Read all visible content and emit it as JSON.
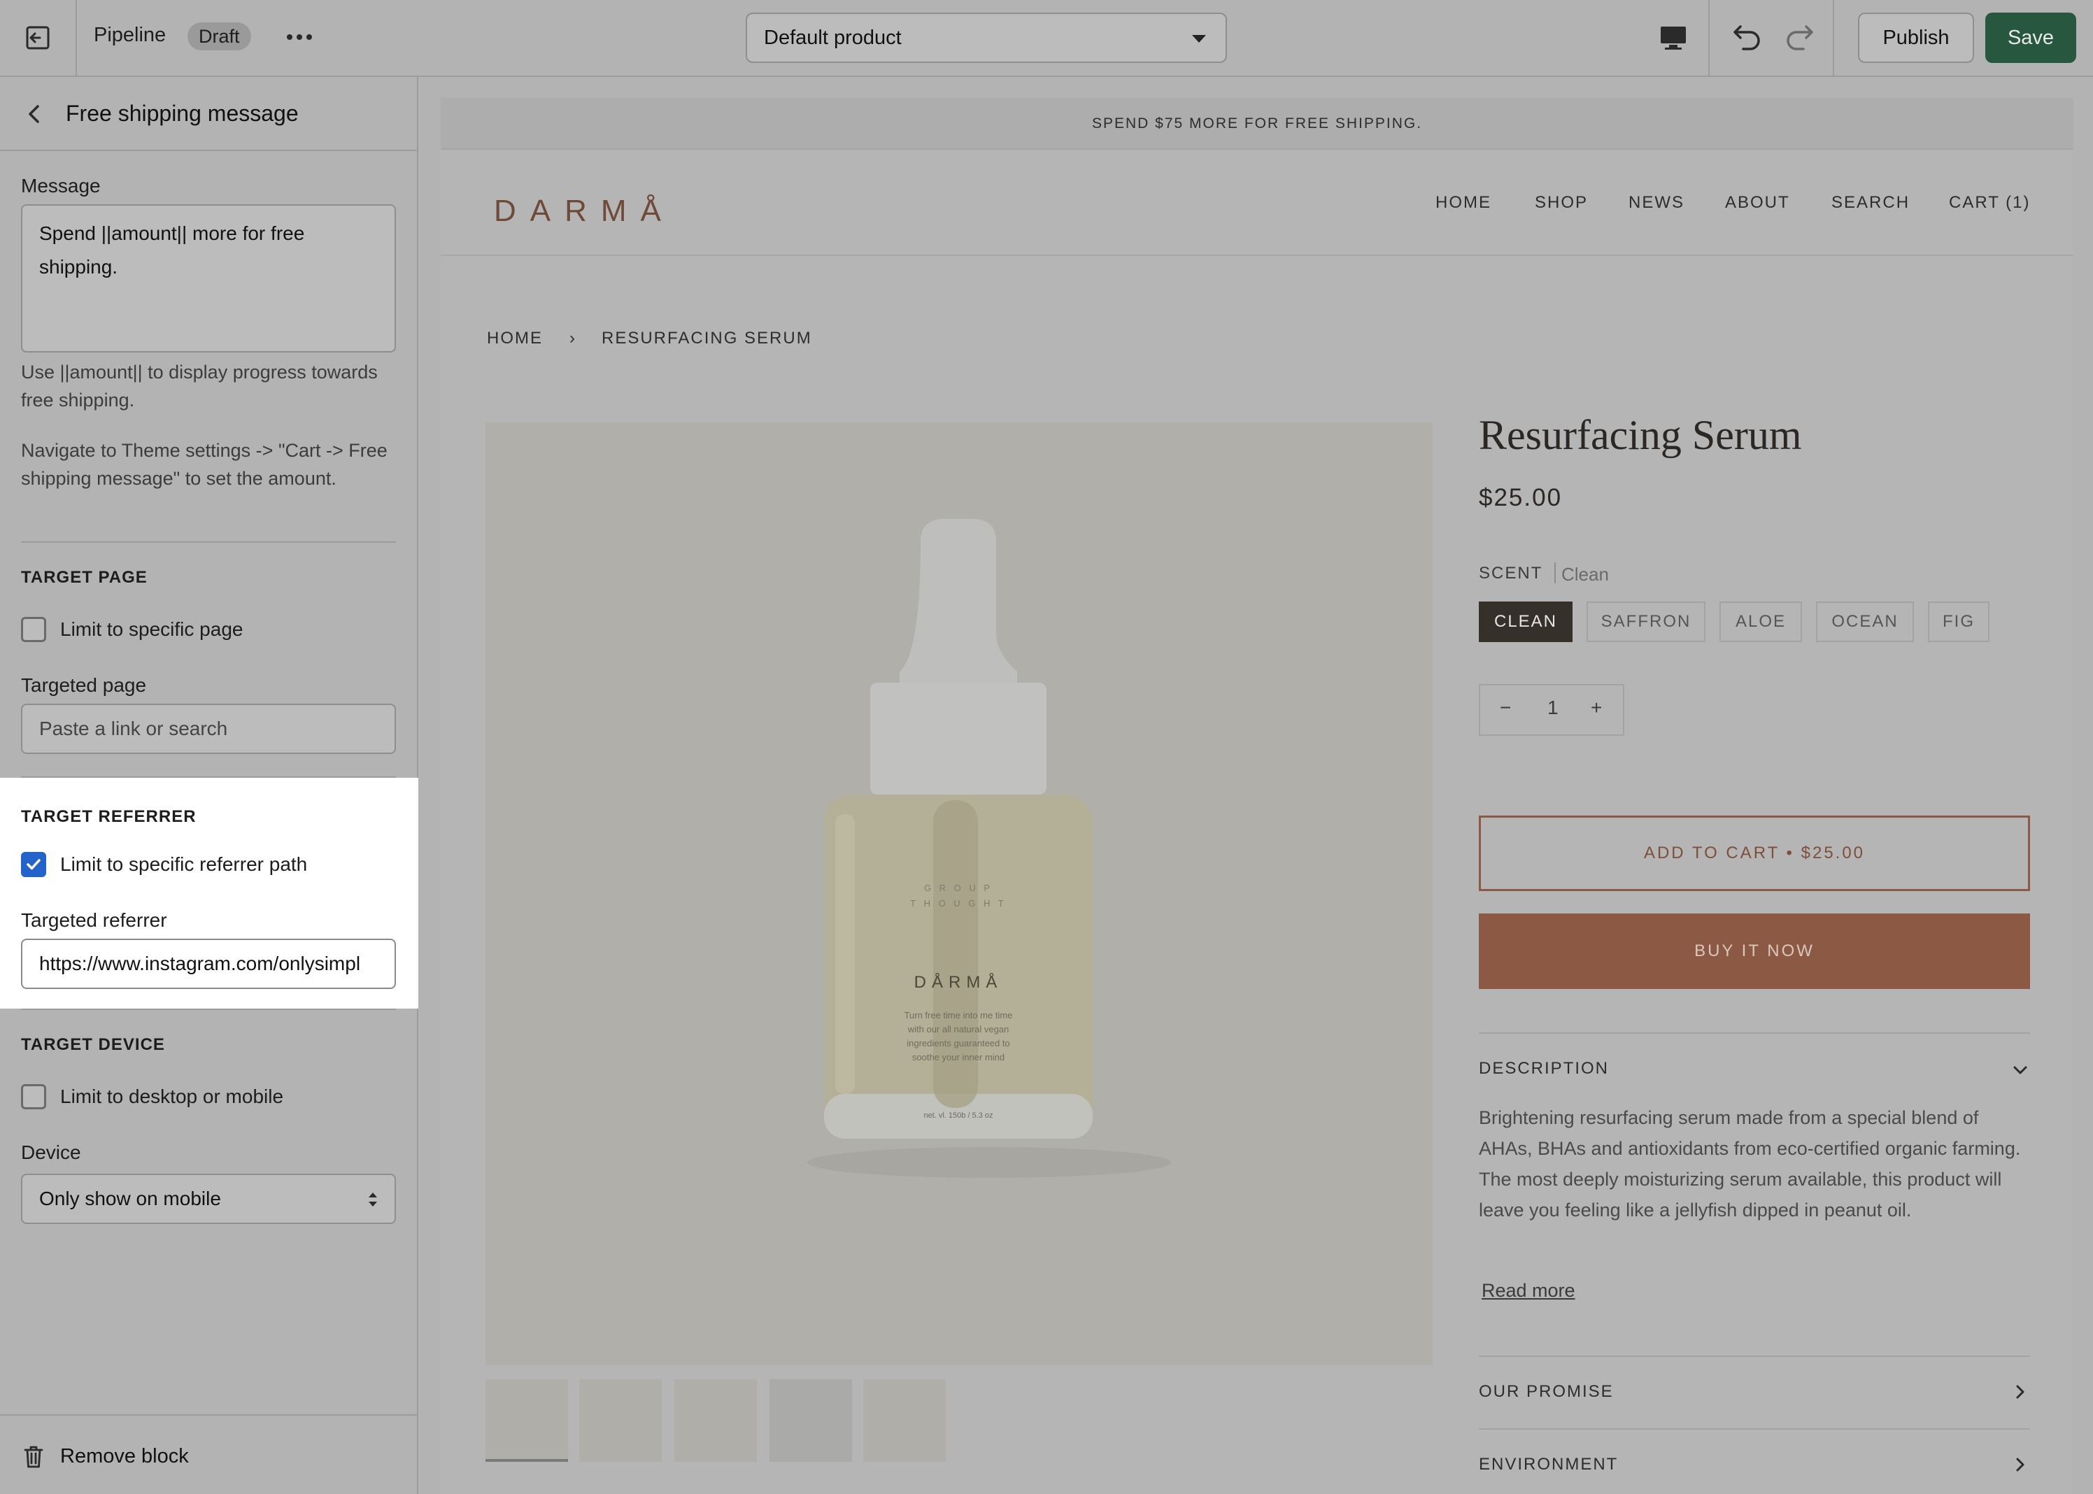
{
  "topbar": {
    "theme_name": "Pipeline",
    "status_badge": "Draft",
    "template_select": "Default product",
    "publish_label": "Publish",
    "save_label": "Save",
    "save_color": "#28573f"
  },
  "sidebar": {
    "title": "Free shipping message",
    "message_label": "Message",
    "message_value": "Spend ||amount|| more for free shipping.",
    "message_help": "Use ||amount|| to display progress towards free shipping.",
    "settings_help": "Navigate to Theme settings -> \"Cart -> Free shipping message\" to set the amount.",
    "target_page": {
      "section_title": "TARGET PAGE",
      "checkbox_label": "Limit to specific page",
      "checked": false,
      "field_label": "Targeted page",
      "placeholder": "Paste a link or search"
    },
    "target_referrer": {
      "section_title": "TARGET REFERRER",
      "checkbox_label": "Limit to specific referrer path",
      "checked": true,
      "field_label": "Targeted referrer",
      "value": "https://www.instagram.com/onlysimpl"
    },
    "target_device": {
      "section_title": "TARGET DEVICE",
      "checkbox_label": "Limit to desktop or mobile",
      "checked": false,
      "field_label": "Device",
      "selected": "Only show on mobile"
    },
    "remove_label": "Remove block",
    "checkbox_color": "#2463c9"
  },
  "preview": {
    "announcement": "SPEND $75 MORE FOR FREE SHIPPING.",
    "logo": "DARMÅ",
    "nav": [
      "HOME",
      "SHOP",
      "NEWS",
      "ABOUT",
      "SEARCH",
      "CART (1)"
    ],
    "breadcrumb": [
      "HOME",
      "›",
      "RESURFACING SERUM"
    ],
    "bottle": {
      "brand_top": "G R O U P",
      "brand_bottom": "T H O U G H T",
      "name": "DÅRMÅ",
      "blurb": [
        "Turn free time into me time",
        "with our all natural vegan",
        "ingredients guaranteed to",
        "soothe your inner mind"
      ],
      "volume": "net. vl. 150b / 5.3 oz"
    },
    "product": {
      "title": "Resurfacing Serum",
      "price": "$25.00",
      "scent_label": "SCENT",
      "scent_value": "Clean",
      "scents": [
        "CLEAN",
        "SAFFRON",
        "ALOE",
        "OCEAN",
        "FIG"
      ],
      "selected_scent": "CLEAN",
      "qty_minus": "−",
      "qty": "1",
      "qty_plus": "+",
      "add_to_cart": "ADD TO CART • $25.00",
      "buy_now": "BUY IT NOW",
      "description_title": "DESCRIPTION",
      "description": "Brightening resurfacing serum made from a special blend of AHAs, BHAs and antioxidants from eco-certified organic farming.  The most deeply moisturizing serum available, this product will leave you feeling like a jellyfish dipped in peanut oil.",
      "read_more": "Read more",
      "promise_title": "OUR PROMISE",
      "environment_title": "ENVIRONMENT",
      "accent_color": "#8c5a44"
    }
  }
}
